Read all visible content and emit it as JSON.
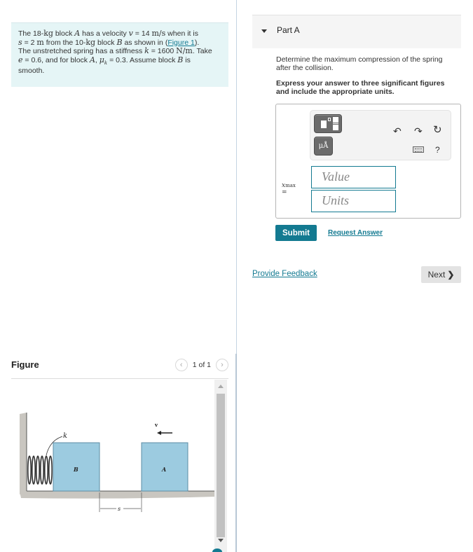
{
  "problem": {
    "segments": {
      "s1": "The 18-",
      "kg1": "kg",
      "s2": " block ",
      "A": "A",
      "s3": " has a velocity ",
      "v": "v",
      "s4": " = 14 ",
      "ms": "m/s",
      "s5": " when it is",
      "s": "s",
      "s6": " = 2 ",
      "m": "m",
      "s7": " from the 10-",
      "kg2": "kg",
      "s8": " block ",
      "B": "B",
      "s9": " as shown in (",
      "figure_link": "Figure 1",
      "s10": ").",
      "s11": "The unstretched spring has a stiffness ",
      "k": "k",
      "s12": " = 1600 ",
      "Nm": "N/m",
      "s13": ". Take",
      "e": "e",
      "s14": " = 0.6, and for block ",
      "A2": "A",
      "s15": ", ",
      "muk": "μ",
      "muk_sub": "k",
      "s16": " = 0.3. Assume block ",
      "B2": "B",
      "s17": " is",
      "s18": "smooth."
    }
  },
  "figure": {
    "title": "Figure",
    "counter": "1 of 1",
    "prev_icon": "‹",
    "next_icon": "›",
    "labels": {
      "k": "k",
      "v": "v",
      "B": "B",
      "A": "A",
      "s": "s"
    },
    "colors": {
      "block": "#9ccbe0",
      "block_border": "#5d8ea5",
      "ground": "#c9c6c0"
    }
  },
  "part": {
    "label": "Part A",
    "question": "Determine the maximum compression of the spring after the collision.",
    "instruction": "Express your answer to three significant figures and include the appropriate units.",
    "toolbar": {
      "units_label": "μÅ",
      "undo_icon": "↶",
      "redo_icon": "↷",
      "reset_icon": "↻",
      "help_icon": "?"
    },
    "variable": {
      "symbol": "x",
      "subscript": "max",
      "equals": "="
    },
    "value_placeholder": "Value",
    "units_placeholder": "Units",
    "submit_label": "Submit",
    "request_answer_label": "Request Answer"
  },
  "footer": {
    "feedback_label": "Provide Feedback",
    "next_label": "Next",
    "next_icon": "❯"
  },
  "colors": {
    "accent": "#137a91",
    "problem_bg": "#e5f5f6",
    "part_bar_bg": "#f5f5f5"
  }
}
